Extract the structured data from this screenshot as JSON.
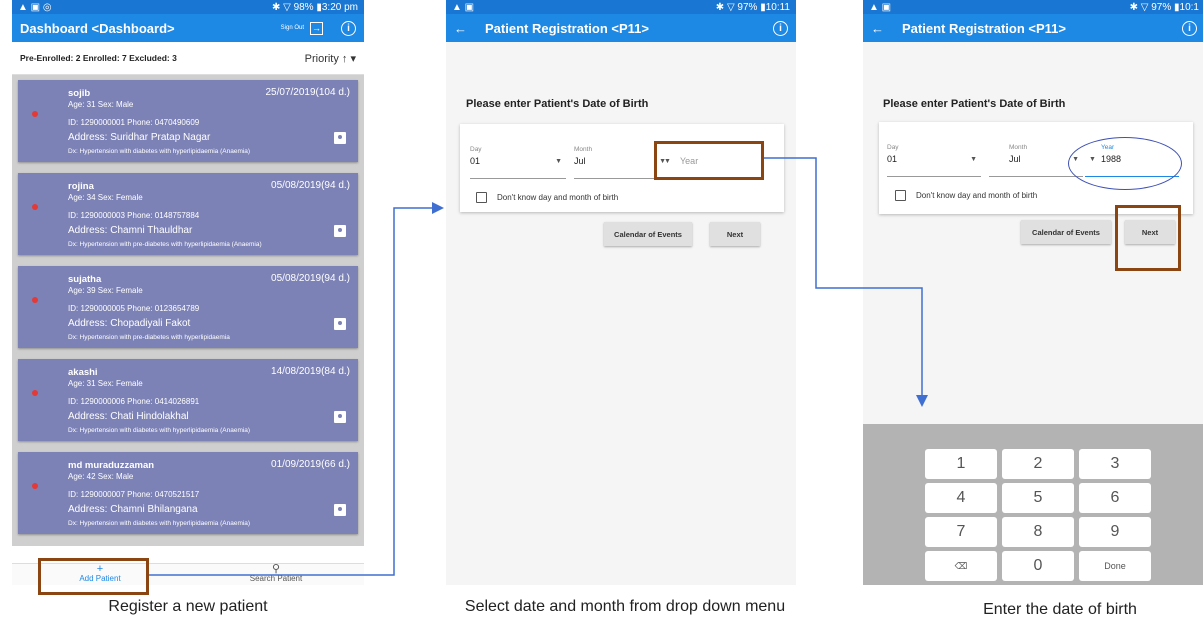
{
  "screen1": {
    "status": {
      "left_icons": "▲ ▣ ◎",
      "right": "✱ ▽ 98% ▮3:20 pm"
    },
    "title": "Dashboard <Dashboard>",
    "signout": "Sign Out",
    "counts": "Pre-Enrolled: 2  Enrolled: 7  Excluded: 3",
    "sort": "Priority ↑ ▾",
    "patients": [
      {
        "name": "sojib",
        "date": "25/07/2019(104 d.)",
        "age": "Age: 31  Sex: Male",
        "id": "ID: 1290000001  Phone: 0470490609",
        "address": "Address: Suridhar Pratap Nagar",
        "dx": "Dx: Hypertension with diabetes with hyperlipidaemia (Anaemia)"
      },
      {
        "name": "rojina",
        "date": "05/08/2019(94 d.)",
        "age": "Age: 34  Sex: Female",
        "id": "ID: 1290000003  Phone: 0148757884",
        "address": "Address: Chamni Thauldhar",
        "dx": "Dx: Hypertension with pre-diabetes with hyperlipidaemia (Anaemia)"
      },
      {
        "name": "sujatha",
        "date": "05/08/2019(94 d.)",
        "age": "Age: 39  Sex: Female",
        "id": "ID: 1290000005  Phone: 0123654789",
        "address": "Address: Chopadiyali Fakot",
        "dx": "Dx: Hypertension with pre-diabetes with hyperlipidaemia"
      },
      {
        "name": "akashi",
        "date": "14/08/2019(84 d.)",
        "age": "Age: 31  Sex: Female",
        "id": "ID: 1290000006  Phone: 0414026891",
        "address": "Address: Chati Hindolakhal",
        "dx": "Dx: Hypertension with diabetes with hyperlipidaemia (Anaemia)"
      },
      {
        "name": "md muraduzzaman",
        "date": "01/09/2019(66 d.)",
        "age": "Age: 42  Sex: Male",
        "id": "ID: 1290000007  Phone: 0470521517",
        "address": "Address: Chamni Bhilangana",
        "dx": "Dx: Hypertension with diabetes with hyperlipidaemia (Anaemia)"
      }
    ],
    "nav_add": "Add Patient",
    "nav_search": "Search Patient",
    "caption": "Register a new patient"
  },
  "screen2": {
    "status": {
      "left_icons": "▲ ▣",
      "right": "✱ ▽ 97% ▮10:11"
    },
    "title": "Patient Registration <P11>",
    "question": "Please enter Patient's Date of Birth",
    "day_label": "Day",
    "day_value": "01",
    "month_label": "Month",
    "month_value": "Jul",
    "year_placeholder": "Year",
    "checkbox": "Don't know day and month of birth",
    "calendar_btn": "Calendar of Events",
    "next_btn": "Next",
    "caption": "Select date and month from drop down menu"
  },
  "screen3": {
    "status": {
      "left_icons": "▲ ▣",
      "right": "✱ ▽ 97% ▮10:1"
    },
    "title": "Patient Registration <P11>",
    "question": "Please enter Patient's Date of Birth",
    "day_label": "Day",
    "day_value": "01",
    "month_label": "Month",
    "month_value": "Jul",
    "year_label": "Year",
    "year_value": "1988",
    "checkbox": "Don't know day and month of birth",
    "calendar_btn": "Calendar of Events",
    "next_btn": "Next",
    "keys": [
      "1",
      "2",
      "3",
      "4",
      "5",
      "6",
      "7",
      "8",
      "9",
      "⌫",
      "0",
      "Done"
    ],
    "caption": "Enter the date of birth"
  },
  "colors": {
    "primary": "#1e88e5",
    "card": "#7c82b6",
    "highlight": "#8b4513",
    "arrow": "#3f6fd1"
  }
}
